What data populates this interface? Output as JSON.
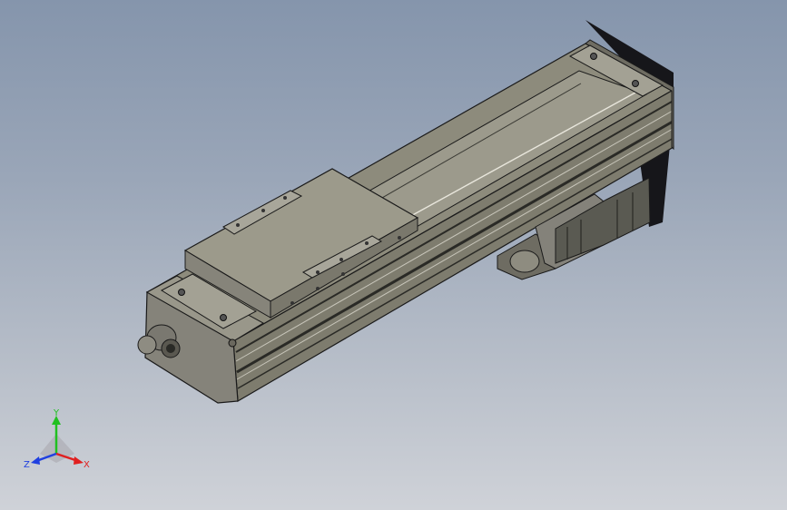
{
  "window": {
    "background_top": "#8595ac",
    "background_bottom": "#cfd2d8"
  },
  "model": {
    "type": "linear-actuator-stage",
    "body_color": "#8d8b7c",
    "carriage_color": "#9c9a8b",
    "edge_color": "#1a1a1a"
  },
  "triad": {
    "x_label": "X",
    "y_label": "Y",
    "z_label": "Z",
    "x_color": "#e02020",
    "y_color": "#20c020",
    "z_color": "#2040e0"
  }
}
